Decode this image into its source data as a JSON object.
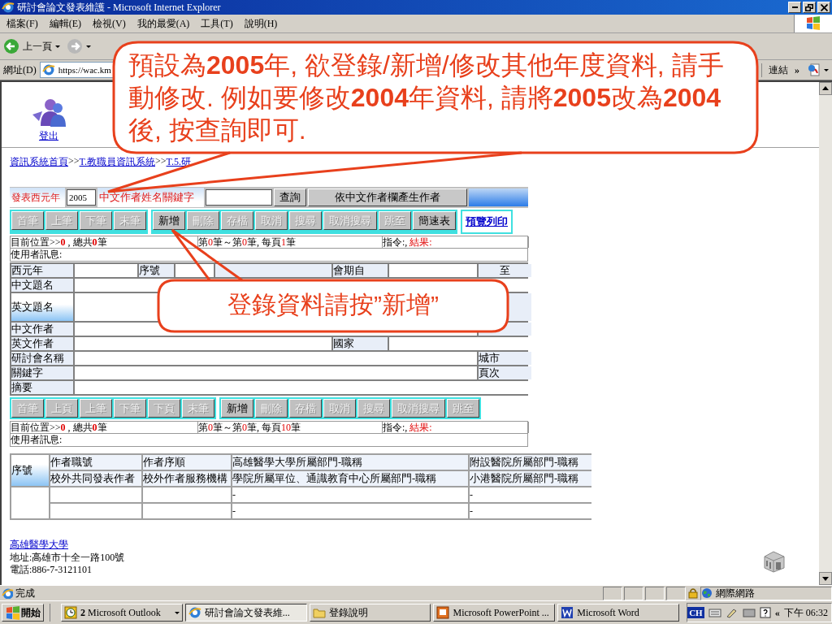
{
  "window": {
    "title": "研討會論文發表維護 - Microsoft Internet Explorer"
  },
  "menu": [
    "檔案(F)",
    "編輯(E)",
    "檢視(V)",
    "我的最愛(A)",
    "工具(T)",
    "說明(H)"
  ],
  "nav": {
    "back": "上一頁"
  },
  "address": {
    "label": "網址(D)",
    "value": "https://wac.km",
    "links": "連結",
    "more": "»"
  },
  "page": {
    "logout": "登出",
    "breadcrumb": [
      {
        "kind": "link",
        "text": "資訊系統首頁"
      },
      {
        "kind": "text",
        "text": ">>"
      },
      {
        "kind": "link",
        "text": "T.教職員資訊系統"
      },
      {
        "kind": "text",
        "text": ">>"
      },
      {
        "kind": "link",
        "text": "T.5.研"
      }
    ],
    "search": {
      "year_label": "發表西元年",
      "year_value": "2005",
      "author_label": "中文作者姓名關鍵字",
      "buttons": [
        "查詢",
        "依中文作者欄產生作者"
      ]
    },
    "toolbar_1": {
      "groups": [
        [
          {
            "kind": "button",
            "label": "首筆",
            "disabled": true
          },
          {
            "kind": "button",
            "label": "上筆",
            "disabled": true
          },
          {
            "kind": "button",
            "label": "下筆",
            "disabled": true
          },
          {
            "kind": "button",
            "label": "末筆",
            "disabled": true
          }
        ],
        [
          {
            "kind": "button",
            "label": "新增",
            "disabled": false
          },
          {
            "kind": "button",
            "label": "刪除",
            "disabled": true
          },
          {
            "kind": "button",
            "label": "存檔",
            "disabled": true
          },
          {
            "kind": "button",
            "label": "取消",
            "disabled": true
          },
          {
            "kind": "button",
            "label": "搜尋",
            "disabled": true
          },
          {
            "kind": "button",
            "label": "取消搜尋",
            "disabled": true
          },
          {
            "kind": "button",
            "label": "跳至",
            "disabled": true
          },
          {
            "kind": "button",
            "label": "簡速表",
            "disabled": false
          }
        ],
        [
          {
            "kind": "link",
            "label": "預覽列印",
            "disabled": false
          }
        ]
      ]
    },
    "info_1": {
      "position": [
        {
          "kind": "plain",
          "text": "目前位置>>"
        },
        {
          "kind": "strong",
          "text": "0"
        },
        {
          "kind": "plain",
          "text": " , 總共"
        },
        {
          "kind": "strong",
          "text": "0"
        },
        {
          "kind": "plain",
          "text": "筆"
        }
      ],
      "range": [
        {
          "kind": "plain",
          "text": "第"
        },
        {
          "kind": "number",
          "text": "0"
        },
        {
          "kind": "plain",
          "text": "筆～第"
        },
        {
          "kind": "number",
          "text": "0"
        },
        {
          "kind": "plain",
          "text": "筆, 每頁"
        },
        {
          "kind": "number",
          "text": "1"
        },
        {
          "kind": "plain",
          "text": "筆"
        }
      ],
      "command": [
        {
          "kind": "plain",
          "text": "指令:,"
        },
        {
          "kind": "number",
          "text": " 結果:"
        }
      ],
      "user_message": "使用者訊息:"
    },
    "form": {
      "rows": [
        {
          "label": "西元年",
          "fields": [
            {
              "kind": "label",
              "label": "序號"
            },
            {
              "kind": "label"
            },
            {
              "kind": "label",
              "label": "會期自"
            },
            {
              "kind": "label",
              "label": "至"
            }
          ]
        },
        {
          "label": "中文題名"
        },
        {
          "label": "英文題名",
          "fields": [
            {
              "kind": "label"
            }
          ]
        },
        {
          "label": "中文作者",
          "fields": [
            {
              "kind": "label"
            }
          ]
        },
        {
          "label": "英文作者",
          "fields": [
            {
              "kind": "label",
              "label": "國家"
            }
          ]
        },
        {
          "label": "研討會名稱",
          "fields": [
            {
              "kind": "label",
              "label": "城市"
            }
          ]
        },
        {
          "label": "關鍵字",
          "fields": [
            {
              "kind": "label",
              "label": "頁次"
            }
          ]
        },
        {
          "label": "摘要"
        }
      ]
    },
    "toolbar_2": {
      "groups": [
        [
          {
            "kind": "button",
            "label": "首筆",
            "disabled": true
          },
          {
            "kind": "button",
            "label": "上頁",
            "disabled": true
          },
          {
            "kind": "button",
            "label": "上筆",
            "disabled": true
          },
          {
            "kind": "button",
            "label": "下筆",
            "disabled": true
          },
          {
            "kind": "button",
            "label": "下頁",
            "disabled": true
          },
          {
            "kind": "button",
            "label": "末筆",
            "disabled": true
          }
        ],
        [
          {
            "kind": "button",
            "label": "新增",
            "disabled": false
          },
          {
            "kind": "button",
            "label": "刪除",
            "disabled": true
          },
          {
            "kind": "button",
            "label": "存檔",
            "disabled": true
          },
          {
            "kind": "button",
            "label": "取消",
            "disabled": true
          },
          {
            "kind": "button",
            "label": "搜尋",
            "disabled": true
          },
          {
            "kind": "button",
            "label": "取消搜尋",
            "disabled": true
          },
          {
            "kind": "button",
            "label": "跳至",
            "disabled": true
          }
        ]
      ]
    },
    "info_2": {
      "position": [
        {
          "kind": "plain",
          "text": "目前位置>>"
        },
        {
          "kind": "strong",
          "text": "0"
        },
        {
          "kind": "plain",
          "text": " , 總共"
        },
        {
          "kind": "strong",
          "text": "0"
        },
        {
          "kind": "plain",
          "text": "筆"
        }
      ],
      "range": [
        {
          "kind": "plain",
          "text": "第"
        },
        {
          "kind": "number",
          "text": "0"
        },
        {
          "kind": "plain",
          "text": "筆～第"
        },
        {
          "kind": "number",
          "text": "0"
        },
        {
          "kind": "plain",
          "text": "筆, 每頁"
        },
        {
          "kind": "number",
          "text": "10"
        },
        {
          "kind": "plain",
          "text": "筆"
        }
      ],
      "command": [
        {
          "kind": "plain",
          "text": "指令:,"
        },
        {
          "kind": "number",
          "text": " 結果:"
        }
      ],
      "user_message": "使用者訊息:"
    },
    "authors_table": {
      "first_column": "序號",
      "header_1": [
        "作者職號",
        "作者序順",
        "高雄醫學大學所屬部門-職稱",
        "附設醫院所屬部門-職稱"
      ],
      "header_2": [
        "校外共同發表作者",
        "校外作者服務機構",
        "學院所屬單位、通識教育中心所屬部門-職稱",
        "小港醫院所屬部門-職稱"
      ],
      "rows": [
        {
          "cells": [
            null,
            null,
            "-",
            "-"
          ]
        },
        {
          "cells": [
            null,
            null,
            "-",
            "-"
          ]
        }
      ]
    },
    "footer": {
      "school": "高雄醫學大學",
      "address": "地址:高雄市十全一路100號",
      "phone": "電話:886-7-3121101"
    }
  },
  "status_bar": {
    "text": "完成",
    "zone": "網際網路"
  },
  "taskbar": {
    "start": "開始",
    "tasks": [
      {
        "kind": "clock",
        "label": "**2** Microsoft Outlook",
        "selected": false
      },
      {
        "kind": "browser",
        "label": "研討會論文發表維...",
        "selected": true
      },
      {
        "kind": "folder",
        "label": "登錄說明",
        "selected": false
      },
      {
        "kind": "slides",
        "label": "Microsoft PowerPoint ...",
        "selected": false
      },
      {
        "kind": "document",
        "label": "Microsoft Word",
        "selected": false
      }
    ],
    "language": "CH",
    "more": "«",
    "time": "下午 06:32"
  },
  "callouts": [
    {
      "text": "預設為**2005**年, 欲登錄/新增/修改其他年度資料, 請手動修改. 例如要修改**2004**年資料, 請將**2005**改為**2004**後, 按查詢即可."
    },
    {
      "text": "登錄資料請按”新增”"
    }
  ]
}
